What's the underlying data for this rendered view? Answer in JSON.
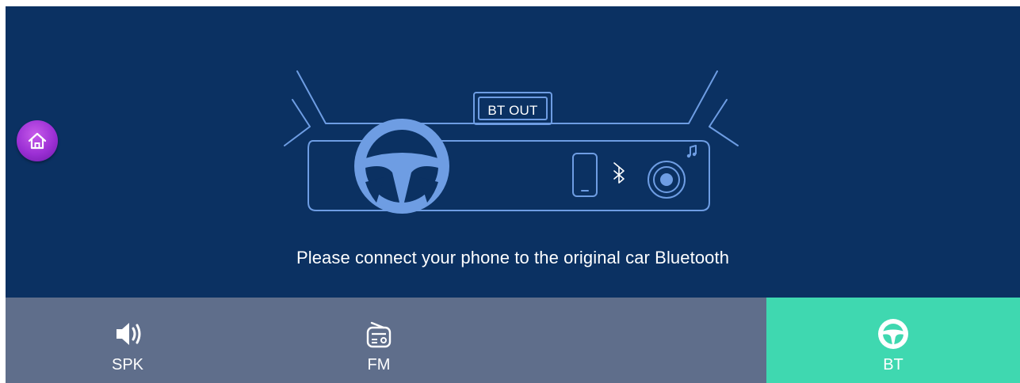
{
  "colors": {
    "background": "#0b3162",
    "illustration_line": "#6e9de3",
    "tab_bar": "#5f6e8b",
    "tab_active": "#3fd8b0",
    "home_button": "#9b2fd4"
  },
  "home": {
    "icon": "home-icon"
  },
  "illustration": {
    "sign_text": "BT OUT",
    "icons": [
      "steering-wheel-icon",
      "phone-icon",
      "bluetooth-icon",
      "speaker-icon",
      "music-note-icon"
    ]
  },
  "message": "Please connect your phone to the original car Bluetooth",
  "tabs": [
    {
      "label": "SPK",
      "icon": "speaker-icon",
      "active": false
    },
    {
      "label": "FM",
      "icon": "radio-icon",
      "active": false
    },
    {
      "label": "BT",
      "icon": "steering-wheel-icon",
      "active": true
    }
  ]
}
